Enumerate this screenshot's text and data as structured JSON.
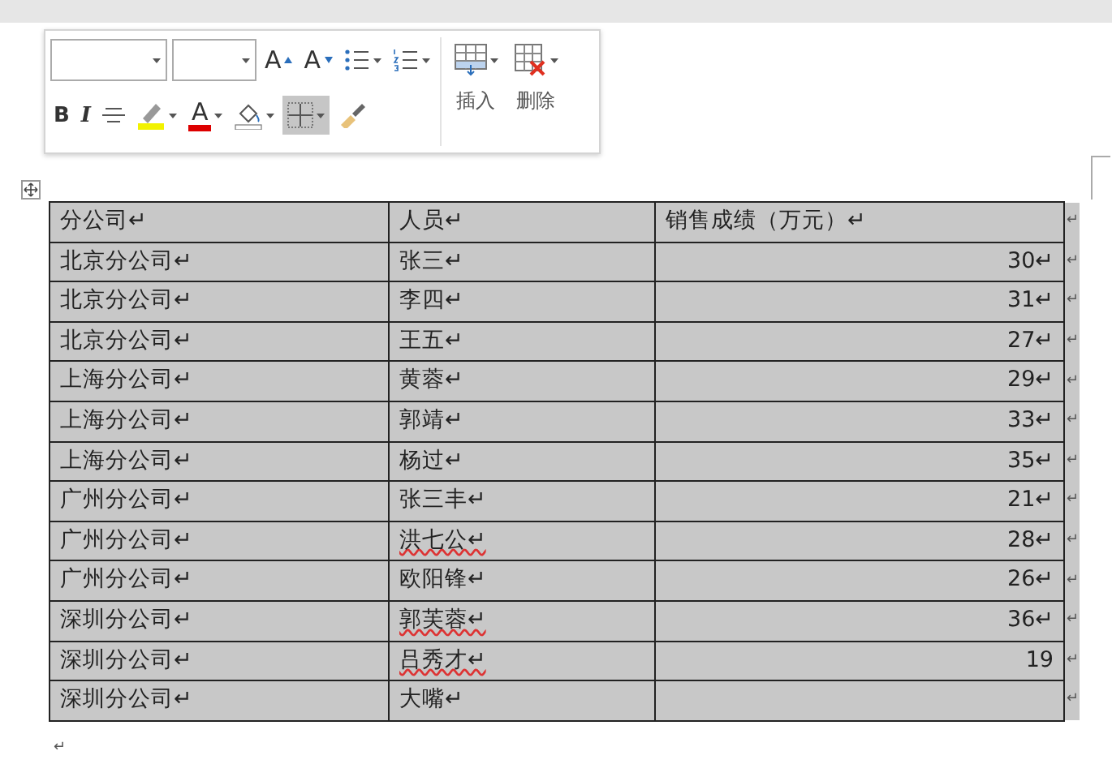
{
  "mini_toolbar": {
    "fields": [
      {
        "kind": "font_name"
      },
      {
        "kind": "font_size"
      }
    ],
    "buttons": [
      {
        "kind": "grow",
        "label": "A"
      },
      {
        "kind": "shrink",
        "label": "A"
      },
      {
        "kind": "bullets"
      },
      {
        "kind": "numbering"
      }
    ],
    "format_buttons": [
      {
        "kind": "bold",
        "label": "B"
      },
      {
        "kind": "italic",
        "label": "I"
      },
      {
        "kind": "center"
      },
      {
        "kind": "highlight"
      },
      {
        "kind": "fontcolor",
        "label": "A"
      },
      {
        "kind": "shading"
      },
      {
        "kind": "borders",
        "selected": true
      },
      {
        "kind": "painter"
      }
    ],
    "insert": {
      "label": "插入"
    },
    "delete": {
      "label": "删除"
    }
  },
  "table": {
    "columns": [
      "分公司↵",
      "人员↵",
      "销售成绩（万元）↵"
    ],
    "rows": [
      {
        "company": "北京分公司↵",
        "person": "张三↵",
        "sales": "30↵"
      },
      {
        "company": "北京分公司↵",
        "person": "李四↵",
        "sales": "31↵"
      },
      {
        "company": "北京分公司↵",
        "person": "王五↵",
        "sales": "27↵"
      },
      {
        "company": "上海分公司↵",
        "person": "黄蓉↵",
        "sales": "29↵"
      },
      {
        "company": "上海分公司↵",
        "person": "郭靖↵",
        "sales": "33↵"
      },
      {
        "company": "上海分公司↵",
        "person": "杨过↵",
        "sales": "35↵"
      },
      {
        "company": "广州分公司↵",
        "person": "张三丰↵",
        "sales": "21↵"
      },
      {
        "company": "广州分公司↵",
        "person": "洪七公↵",
        "sales": "28↵",
        "spell_error": true
      },
      {
        "company": "广州分公司↵",
        "person": "欧阳锋↵",
        "sales": "26↵"
      },
      {
        "company": "深圳分公司↵",
        "person": "郭芙蓉↵",
        "sales": "36↵",
        "spell_error": true
      },
      {
        "company": "深圳分公司↵",
        "person": "吕秀才↵",
        "sales": "19",
        "spell_error": true
      },
      {
        "company": "深圳分公司↵",
        "person": "大嘴↵",
        "sales": ""
      }
    ],
    "row_end_mark": "↵"
  },
  "after_table_mark": "↵"
}
